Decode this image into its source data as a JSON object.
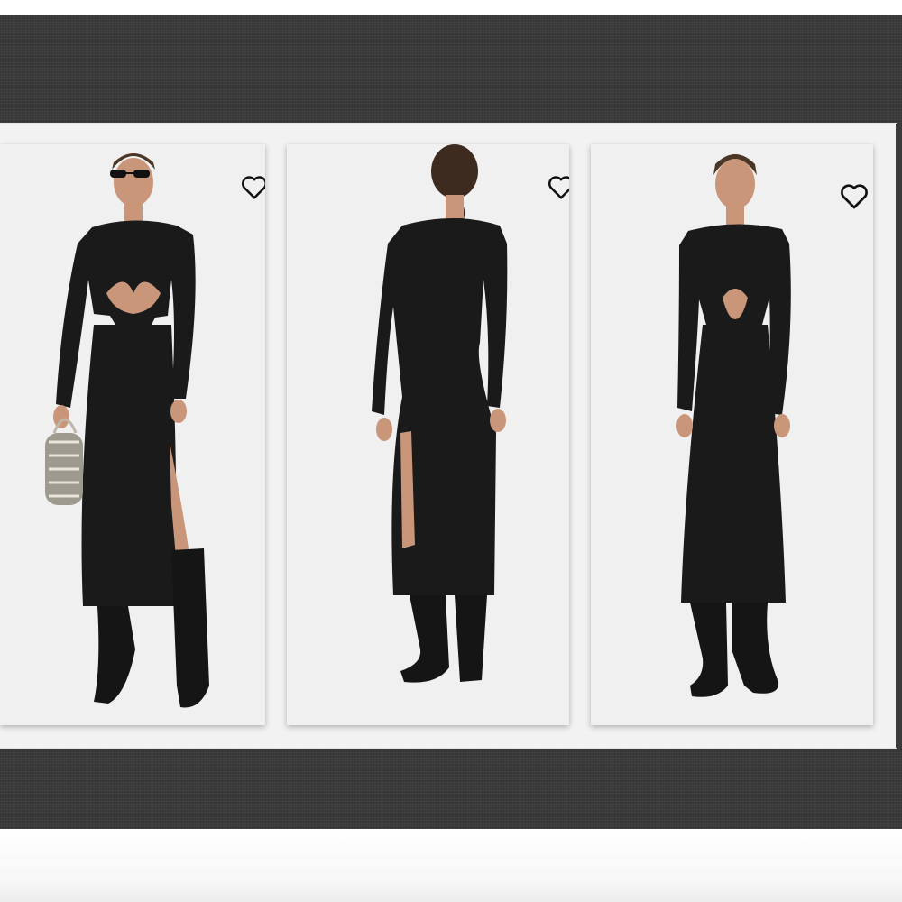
{
  "carousel": {
    "products": [
      {
        "view": "front",
        "accessory": "woven-handbag",
        "favorite_icon": "heart-outline-icon"
      },
      {
        "view": "back",
        "favorite_icon": "heart-outline-icon"
      },
      {
        "view": "front",
        "favorite_icon": "heart-outline-icon"
      }
    ]
  },
  "colors": {
    "background_band": "#3a3a3a",
    "card": "#f0f0f0",
    "dress": "#1a1a1a",
    "skin": "#c9967a"
  }
}
